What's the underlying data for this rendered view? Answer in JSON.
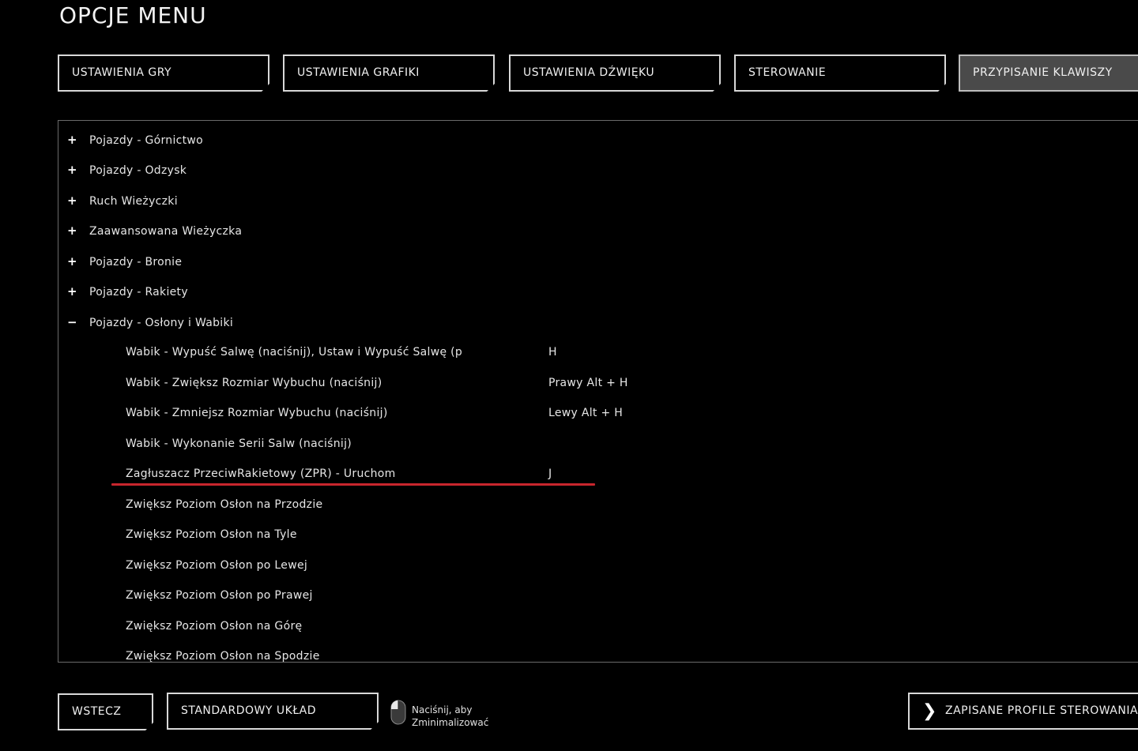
{
  "header": {
    "title": "OPCJE MENU"
  },
  "tabs": [
    {
      "label": "USTAWIENIA GRY"
    },
    {
      "label": "USTAWIENIA GRAFIKI"
    },
    {
      "label": "USTAWIENIA DŹWIĘKU"
    },
    {
      "label": "STEROWANIE"
    },
    {
      "label": "PRZYPISANIE KLAWISZY",
      "active": true
    }
  ],
  "categories": [
    {
      "sign": "+",
      "label": "Pojazdy - Górnictwo"
    },
    {
      "sign": "+",
      "label": "Pojazdy - Odzysk"
    },
    {
      "sign": "+",
      "label": "Ruch Wieżyczki"
    },
    {
      "sign": "+",
      "label": "Zaawansowana Wieżyczka"
    },
    {
      "sign": "+",
      "label": "Pojazdy - Bronie"
    },
    {
      "sign": "+",
      "label": "Pojazdy - Rakiety"
    },
    {
      "sign": "−",
      "label": "Pojazdy - Osłony i Wabiki"
    }
  ],
  "bindings": [
    {
      "label": "Wabik - Wypuść Salwę (naciśnij), Ustaw i Wypuść Salwę (przytrzymaj)",
      "key": "H"
    },
    {
      "label": "Wabik - Zwiększ Rozmiar Wybuchu (naciśnij)",
      "key": "Prawy Alt + H"
    },
    {
      "label": "Wabik - Zmniejsz Rozmiar Wybuchu (naciśnij)",
      "key": "Lewy Alt + H"
    },
    {
      "label": "Wabik - Wykonanie Serii Salw (naciśnij)",
      "key": ""
    },
    {
      "label": "Zagłuszacz PrzeciwRakietowy (ZPR) - Uruchom",
      "key": "J"
    },
    {
      "label": "Zwiększ Poziom Osłon na Przodzie",
      "key": ""
    },
    {
      "label": "Zwiększ Poziom Osłon na Tyle",
      "key": ""
    },
    {
      "label": "Zwiększ Poziom Osłon po Lewej",
      "key": ""
    },
    {
      "label": "Zwiększ Poziom Osłon po Prawej",
      "key": ""
    },
    {
      "label": "Zwiększ Poziom Osłon na Górę",
      "key": ""
    },
    {
      "label": "Zwiększ Poziom Osłon na Spodzie",
      "key": ""
    }
  ],
  "footer": {
    "back_label": "WSTECZ",
    "default_label": "STANDARDOWY UKŁAD KLAWISZY",
    "hint_line1": "Naciśnij, aby",
    "hint_line2": "Zminimalizować",
    "profiles_label": "ZAPISANE PROFILE STEROWANIA"
  },
  "colors": {
    "highlight": "#c8262d",
    "active_tab": "#4a4a4a"
  },
  "icons": {
    "mouse": "mouse-icon",
    "chevron": "chevron-right-icon"
  }
}
